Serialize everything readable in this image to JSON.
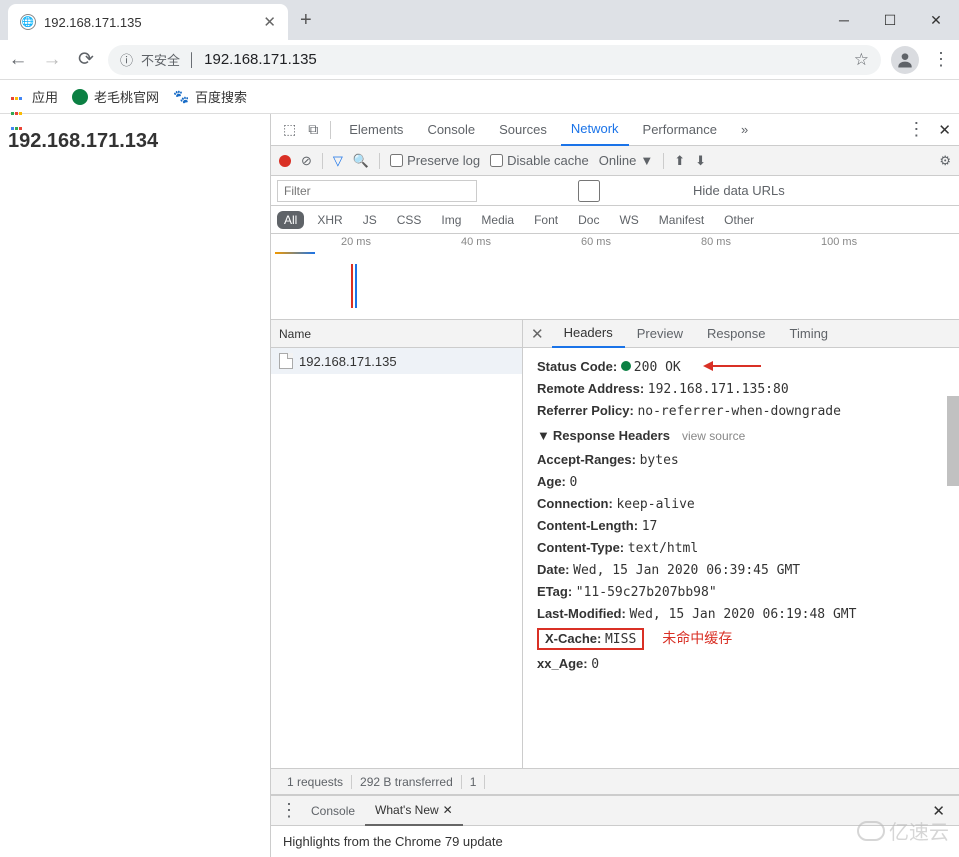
{
  "tab": {
    "title": "192.168.171.135"
  },
  "address": {
    "warn_text": "不安全",
    "url": "192.168.171.135"
  },
  "bookmarks": {
    "apps": "应用",
    "items": [
      {
        "label": "老毛桃官网"
      },
      {
        "label": "百度搜索"
      }
    ]
  },
  "page_body": "192.168.171.134",
  "devtools": {
    "tabs": [
      "Elements",
      "Console",
      "Sources",
      "Network",
      "Performance"
    ],
    "active_tab": "Network",
    "more": "»",
    "toolbar": {
      "preserve": "Preserve log",
      "disable_cache": "Disable cache",
      "throttle": "Online"
    },
    "filter": {
      "placeholder": "Filter",
      "hide_urls": "Hide data URLs"
    },
    "types": [
      "All",
      "XHR",
      "JS",
      "CSS",
      "Img",
      "Media",
      "Font",
      "Doc",
      "WS",
      "Manifest",
      "Other"
    ],
    "timeline_ticks": [
      "20 ms",
      "40 ms",
      "60 ms",
      "80 ms",
      "100 ms"
    ],
    "name_header": "Name",
    "requests": [
      {
        "name": "192.168.171.135"
      }
    ],
    "detail_tabs": [
      "Headers",
      "Preview",
      "Response",
      "Timing"
    ],
    "active_detail": "Headers",
    "general": {
      "status_code_k": "Status Code:",
      "status_code_v": "200 OK",
      "remote_k": "Remote Address:",
      "remote_v": "192.168.171.135:80",
      "ref_k": "Referrer Policy:",
      "ref_v": "no-referrer-when-downgrade"
    },
    "resp_headers_title": "Response Headers",
    "view_source": "view source",
    "resp_headers": [
      {
        "k": "Accept-Ranges:",
        "v": "bytes"
      },
      {
        "k": "Age:",
        "v": "0"
      },
      {
        "k": "Connection:",
        "v": "keep-alive"
      },
      {
        "k": "Content-Length:",
        "v": "17"
      },
      {
        "k": "Content-Type:",
        "v": "text/html"
      },
      {
        "k": "Date:",
        "v": "Wed, 15 Jan 2020 06:39:45 GMT"
      },
      {
        "k": "ETag:",
        "v": "\"11-59c27b207bb98\""
      },
      {
        "k": "Last-Modified:",
        "v": "Wed, 15 Jan 2020 06:19:48 GMT"
      }
    ],
    "xcache": {
      "k": "X-Cache:",
      "v": "MISS"
    },
    "annotation": "未命中缓存",
    "xxage": {
      "k": "xx_Age:",
      "v": "0"
    },
    "status_bar": {
      "requests": "1 requests",
      "transferred": "292 B transferred",
      "third": "1"
    },
    "drawer": {
      "tabs": [
        "Console",
        "What's New"
      ],
      "active": "What's New",
      "update": "Highlights from the Chrome 79 update"
    }
  },
  "watermark": "亿速云"
}
